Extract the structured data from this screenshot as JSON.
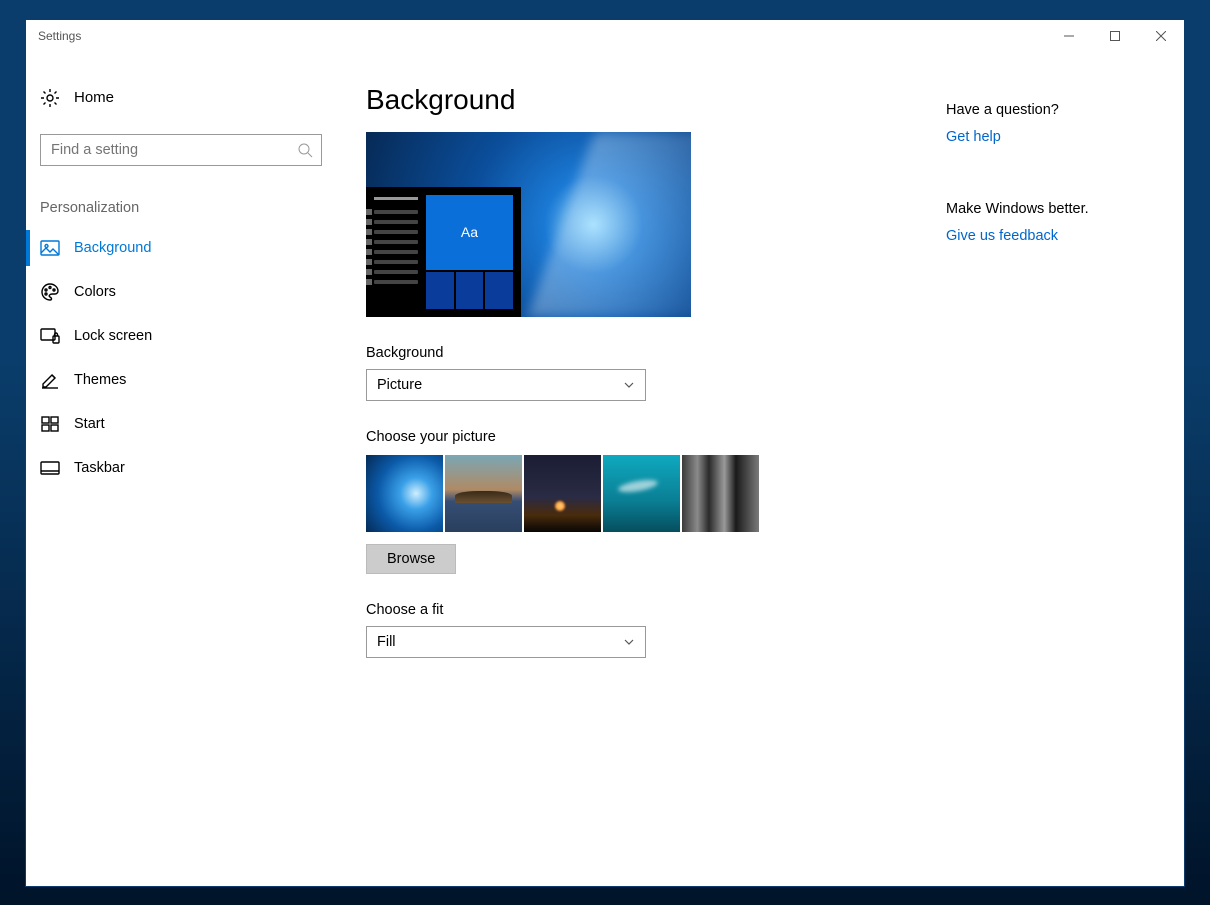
{
  "window": {
    "title": "Settings"
  },
  "sidebar": {
    "home": "Home",
    "search_placeholder": "Find a setting",
    "category": "Personalization",
    "items": [
      {
        "label": "Background",
        "active": true
      },
      {
        "label": "Colors"
      },
      {
        "label": "Lock screen"
      },
      {
        "label": "Themes"
      },
      {
        "label": "Start"
      },
      {
        "label": "Taskbar"
      }
    ]
  },
  "main": {
    "title": "Background",
    "preview_sample_text": "Aa",
    "background_label": "Background",
    "background_value": "Picture",
    "choose_picture_label": "Choose your picture",
    "browse_label": "Browse",
    "fit_label": "Choose a fit",
    "fit_value": "Fill"
  },
  "aside": {
    "q_title": "Have a question?",
    "q_link": "Get help",
    "fb_title": "Make Windows better.",
    "fb_link": "Give us feedback"
  }
}
